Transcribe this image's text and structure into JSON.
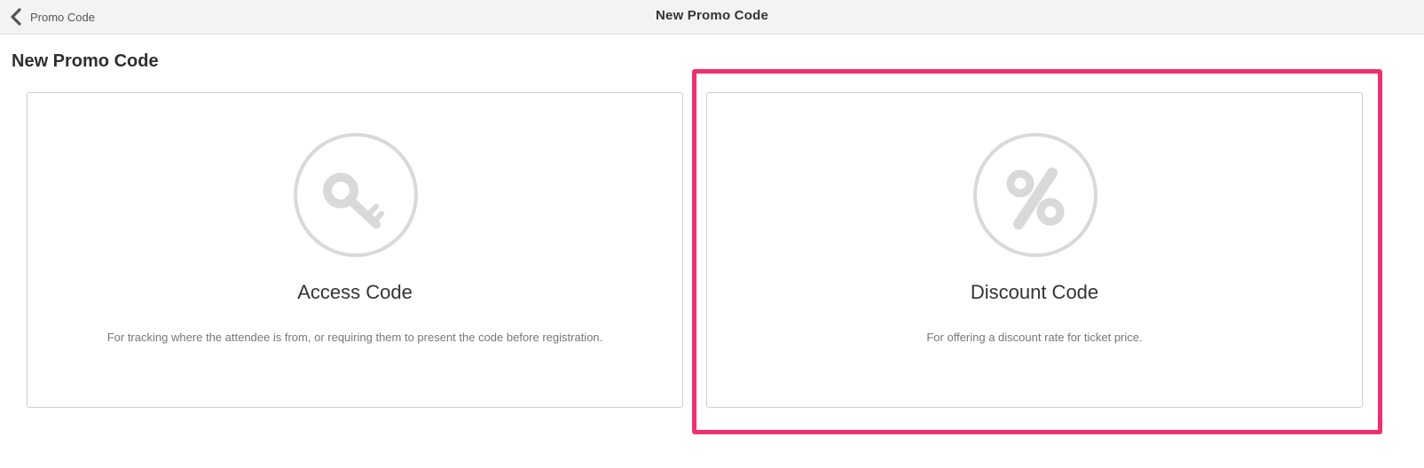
{
  "header": {
    "back_label": "Promo Code",
    "title": "New Promo Code"
  },
  "page": {
    "title": "New Promo Code"
  },
  "options": [
    {
      "title": "Access Code",
      "description": "For tracking where the attendee is from, or requiring them to present the code before registration.",
      "icon": "key-icon"
    },
    {
      "title": "Discount Code",
      "description": "For offering a discount rate for ticket price.",
      "icon": "percent-icon"
    }
  ],
  "colors": {
    "highlight": "#f0306e",
    "icon_gray": "#d9d9d9"
  }
}
